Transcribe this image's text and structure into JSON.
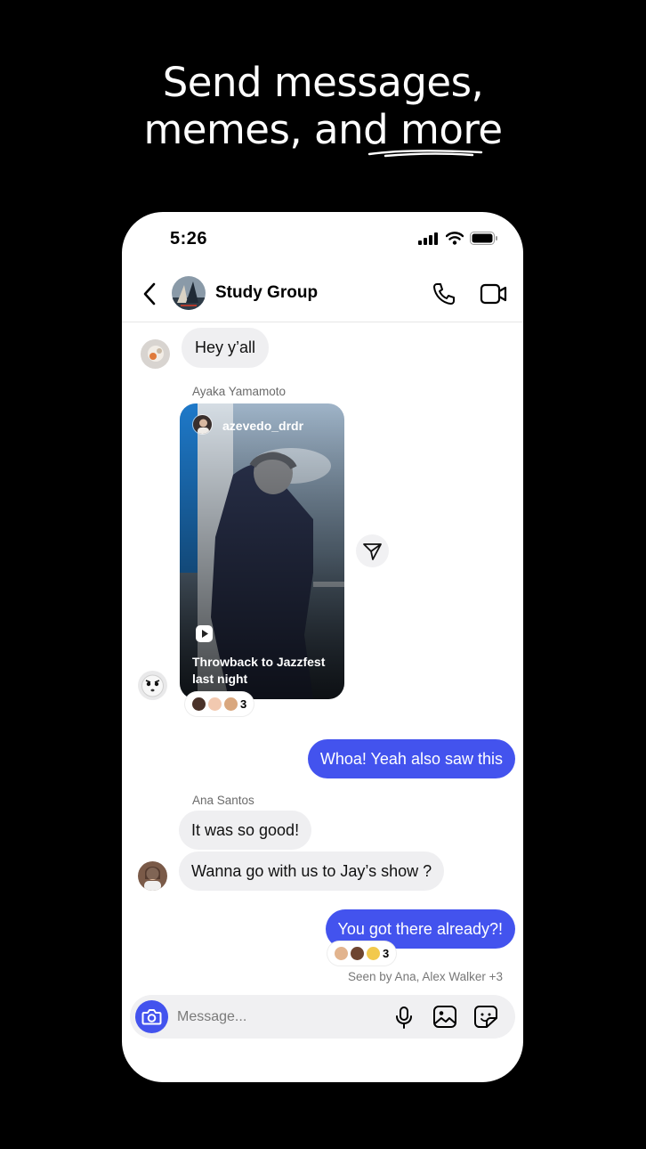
{
  "headline": {
    "line1": "Send messages,",
    "line2": "memes, and more"
  },
  "status_bar": {
    "time": "5:26"
  },
  "chat": {
    "title": "Study Group",
    "messages": {
      "m1": "Hey y’all",
      "sender_ayaka": "Ayaka Yamamoto",
      "reel_user": "azevedo_drdr",
      "reel_caption": "Throwback to Jazzfest last night",
      "reel_reaction_count": "3",
      "m2": "Whoa! Yeah also saw this",
      "sender_ana": "Ana Santos",
      "m3": "It was so good!",
      "m4": "Wanna go with us to Jay’s show ?",
      "m5": "You got there already?!",
      "m5_reaction_count": "3"
    },
    "seen": "Seen by Ana, Alex Walker +3"
  },
  "composer": {
    "placeholder": "Message..."
  },
  "colors": {
    "accent": "#4353ee",
    "incoming_bubble": "#efeff1",
    "background": "#000000"
  }
}
